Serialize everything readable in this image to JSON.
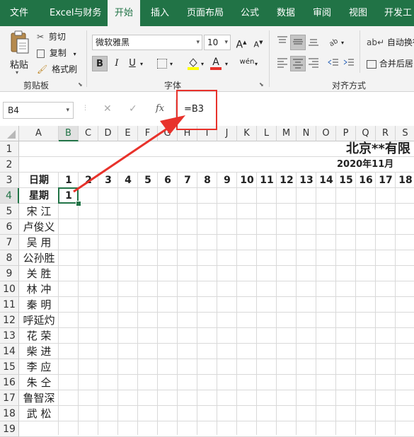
{
  "tabs": [
    "文件",
    "Excel与财务",
    "开始",
    "插入",
    "页面布局",
    "公式",
    "数据",
    "审阅",
    "视图",
    "开发工"
  ],
  "active_tab": "开始",
  "clipboard": {
    "paste": "粘贴",
    "cut": "剪切",
    "copy": "复制",
    "format_painter": "格式刷",
    "group_label": "剪贴板"
  },
  "font": {
    "name": "微软雅黑",
    "size": "10",
    "bold": "B",
    "italic": "I",
    "underline": "U",
    "grow": "A",
    "shrink": "A",
    "font_color": "A",
    "wen": "wén",
    "group_label": "字体"
  },
  "alignment": {
    "wrap_text": "自动换行",
    "merge_center": "合并后居",
    "group_label": "对齐方式"
  },
  "formula_bar": {
    "name_box": "B4",
    "cancel": "✕",
    "enter": "✓",
    "fx": "fx",
    "formula": "=B3"
  },
  "columns": [
    "A",
    "B",
    "C",
    "D",
    "E",
    "F",
    "G",
    "H",
    "I",
    "J",
    "K",
    "L",
    "M",
    "N",
    "O",
    "P",
    "Q",
    "R",
    "S"
  ],
  "selected_column": "B",
  "rows": [
    "1",
    "2",
    "3",
    "4",
    "5",
    "6",
    "7",
    "8",
    "9",
    "10",
    "11",
    "12",
    "13",
    "14",
    "15",
    "16",
    "17",
    "18",
    "19"
  ],
  "selected_row": "4",
  "sheet": {
    "title": "北京**有限",
    "date": "2020年11月",
    "row3_label": "日期",
    "row4_label": "星期",
    "day_numbers": [
      "1",
      "2",
      "3",
      "4",
      "5",
      "6",
      "7",
      "8",
      "9",
      "10",
      "11",
      "12",
      "13",
      "14",
      "15",
      "16",
      "17",
      "18"
    ],
    "b4_value": "1",
    "names": [
      "宋 江",
      "卢俊义",
      "吴 用",
      "公孙胜",
      "关 胜",
      "林 冲",
      "秦 明",
      "呼延灼",
      "花 荣",
      "柴 进",
      "李 应",
      "朱 仝",
      "鲁智深",
      "武 松"
    ]
  },
  "colors": {
    "brand": "#217346",
    "annotation": "#e8322b",
    "active_border": "#217346"
  }
}
